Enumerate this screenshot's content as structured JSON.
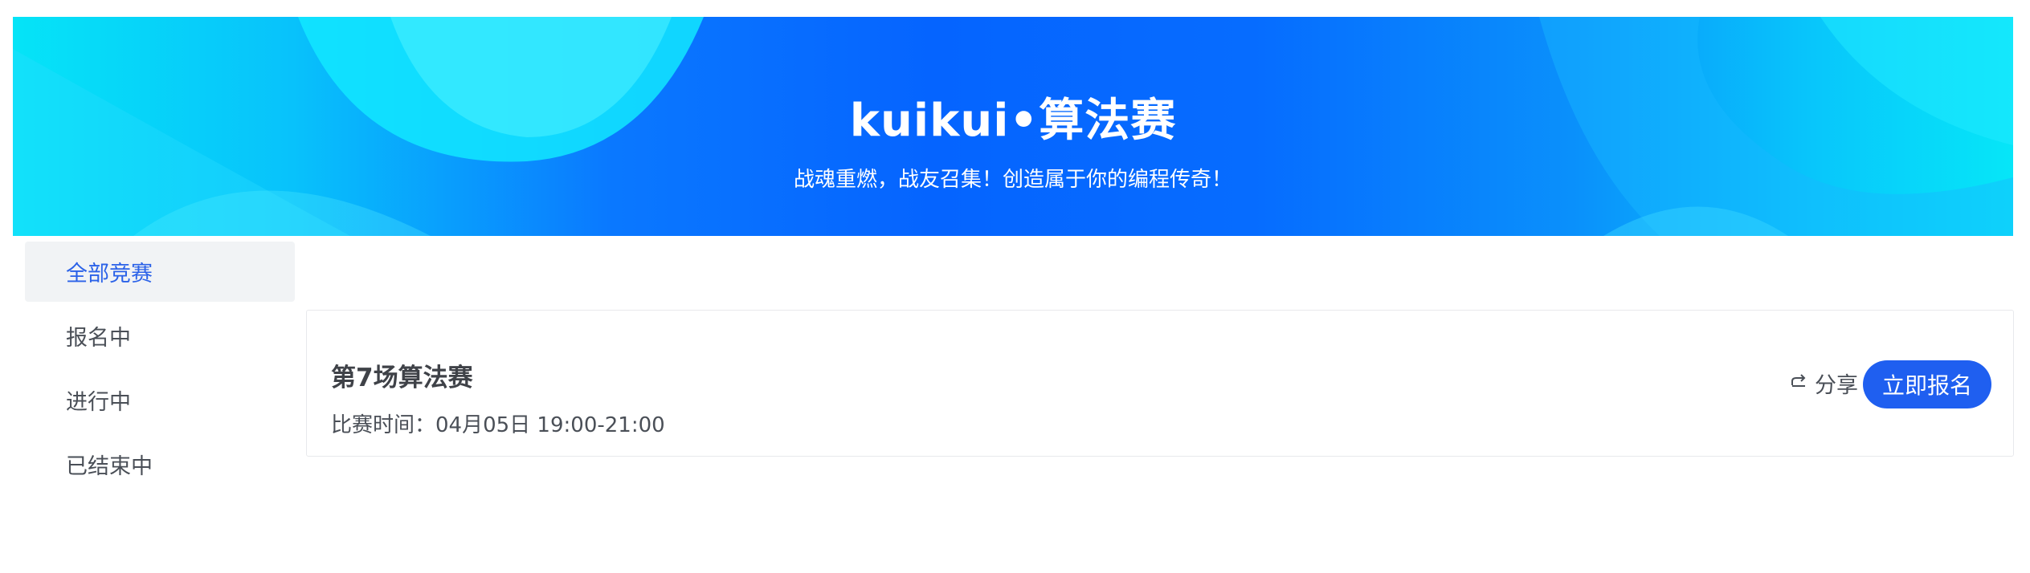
{
  "banner": {
    "title": "kuikui•算法赛",
    "subtitle": "战魂重燃，战友召集！创造属于你的编程传奇！"
  },
  "sidebar": {
    "items": [
      {
        "label": "全部竞赛",
        "active": true
      },
      {
        "label": "报名中",
        "active": false
      },
      {
        "label": "进行中",
        "active": false
      },
      {
        "label": "已结束中",
        "active": false
      }
    ]
  },
  "contests": [
    {
      "title": "第7场算法赛",
      "time": "比赛时间：04月05日 19:00-21:00",
      "share_label": "分享",
      "share_icon": "share-icon",
      "signup_label": "立即报名"
    }
  ],
  "colors": {
    "accent": "#1f5ff0",
    "active_text": "#2b62e8",
    "active_bg": "#f1f3f5"
  }
}
